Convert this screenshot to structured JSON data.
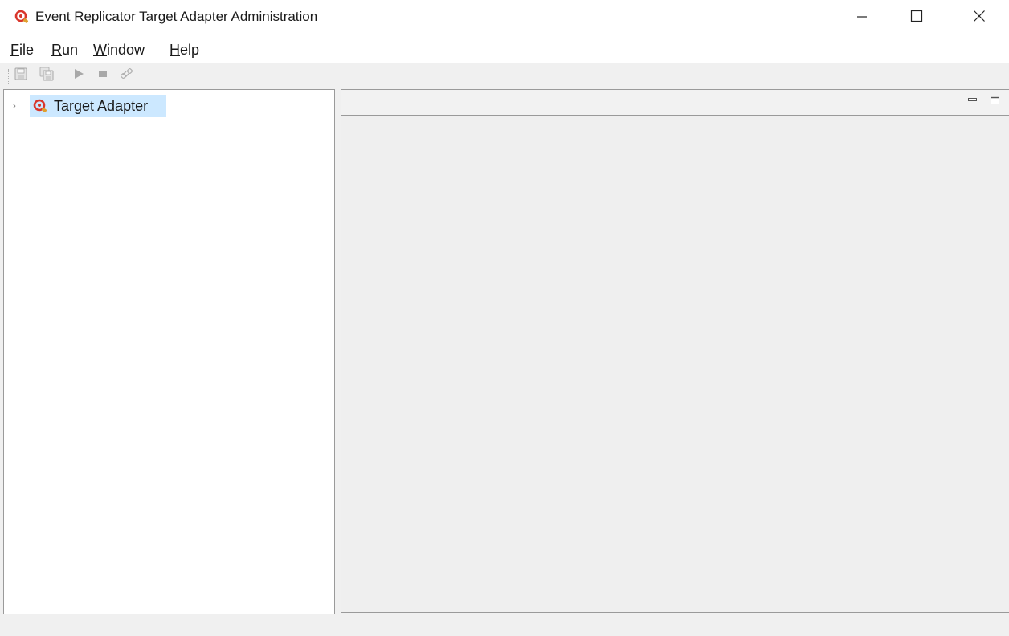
{
  "window": {
    "title": "Event Replicator Target Adapter Administration",
    "icon": "adapter-app-icon",
    "controls": {
      "minimize_icon": "minimize-icon",
      "maximize_icon": "maximize-icon",
      "close_icon": "close-icon"
    }
  },
  "menu": {
    "items": [
      {
        "mnemonic": "F",
        "rest": "ile"
      },
      {
        "mnemonic": "R",
        "rest": "un"
      },
      {
        "mnemonic": "W",
        "rest": "indow"
      },
      {
        "mnemonic": "H",
        "rest": "elp"
      }
    ]
  },
  "toolbar": {
    "buttons": [
      {
        "icon": "save-icon",
        "enabled": false
      },
      {
        "icon": "save-all-icon",
        "enabled": false
      },
      {
        "icon": "run-icon",
        "enabled": false
      },
      {
        "icon": "stop-icon",
        "enabled": false
      },
      {
        "icon": "refresh-link-icon",
        "enabled": false
      }
    ]
  },
  "tree": {
    "items": [
      {
        "label": "Target Adapter",
        "icon": "adapter-icon",
        "expanded": false,
        "selected": true
      }
    ]
  },
  "colors": {
    "selection": "#cce8ff",
    "icon_red": "#d9362c",
    "disabled_icon": "#a8a8a8"
  }
}
